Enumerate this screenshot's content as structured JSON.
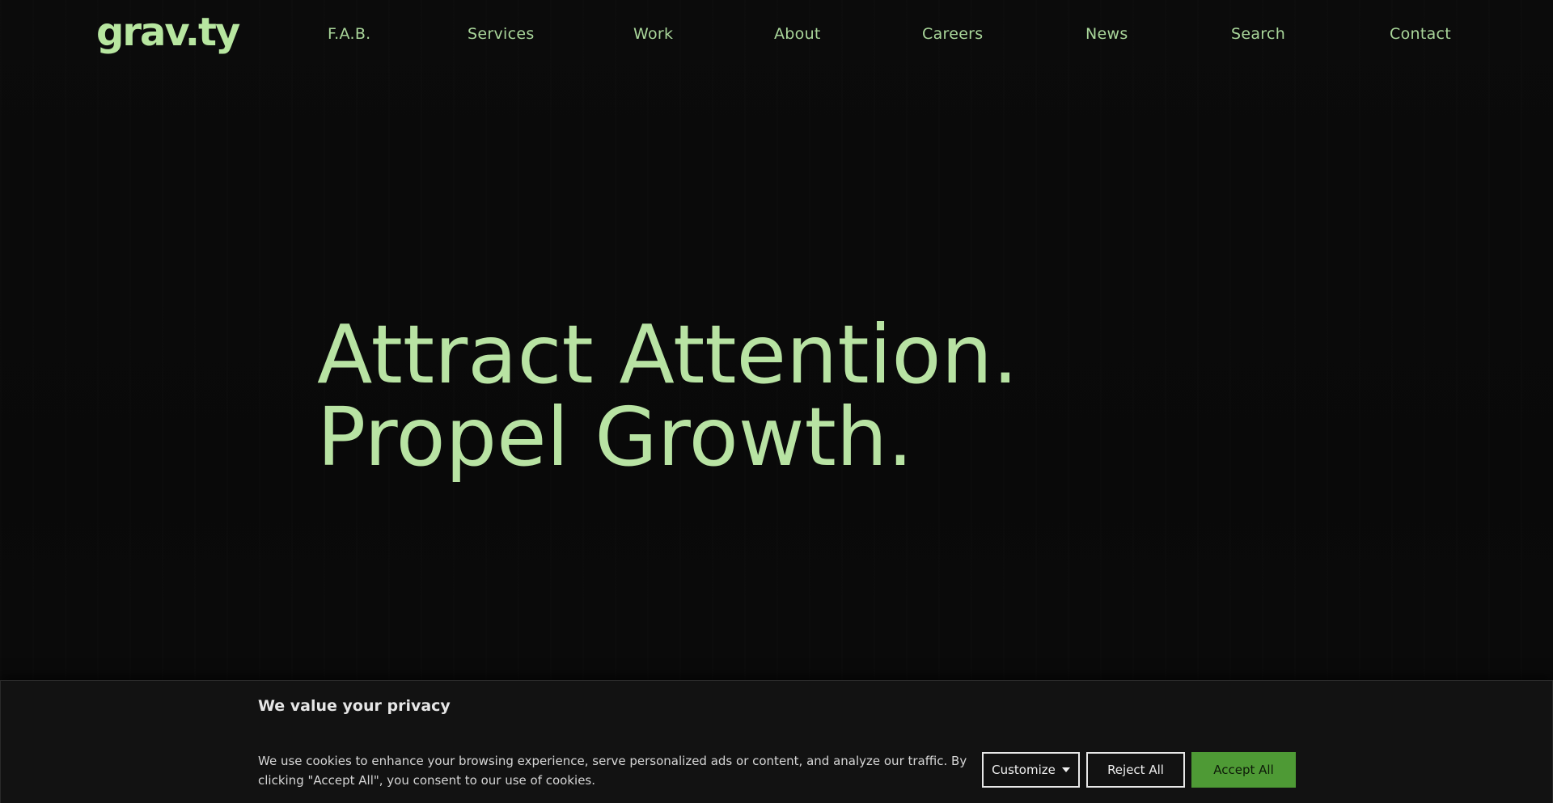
{
  "brand": {
    "logo_text": "grav.ty",
    "accent_color": "#b7e6a0"
  },
  "nav": {
    "items": [
      {
        "label": "F.A.B."
      },
      {
        "label": "Services"
      },
      {
        "label": "Work"
      },
      {
        "label": "About"
      },
      {
        "label": "Careers"
      },
      {
        "label": "News"
      },
      {
        "label": "Search"
      },
      {
        "label": "Contact"
      }
    ]
  },
  "hero": {
    "line1": "Attract Attention.",
    "line2": "Propel Growth.",
    "color": "#b8e3a3"
  },
  "cookie_banner": {
    "title": "We value your privacy",
    "text": "We use cookies to enhance your browsing experience, serve personalized ads or content, and analyze our traffic. By clicking \"Accept All\", you consent to our use of cookies.",
    "customize_label": "Customize",
    "reject_label": "Reject All",
    "accept_label": "Accept All",
    "accept_color": "#4e9a35"
  }
}
